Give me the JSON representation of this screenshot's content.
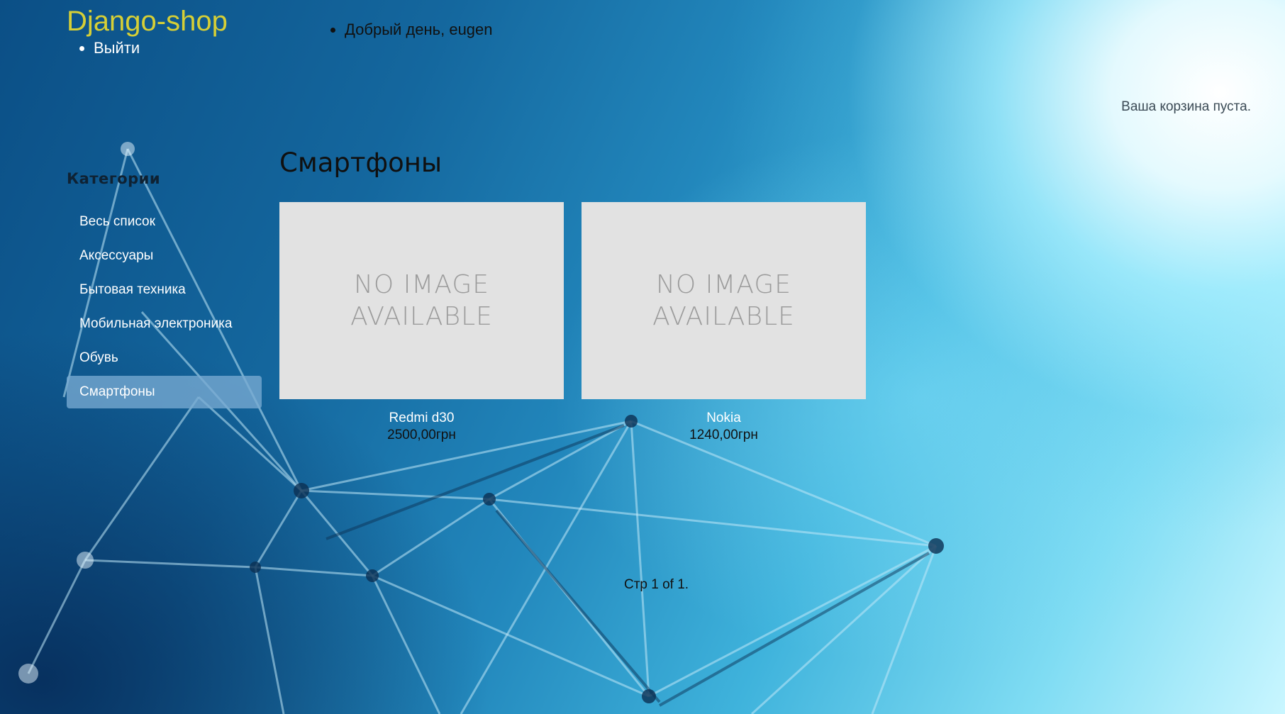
{
  "header": {
    "logo": "Django-shop",
    "greeting": "Добрый день, eugen",
    "logout": "Выйти"
  },
  "cart": {
    "status": "Ваша корзина пуста."
  },
  "sidebar": {
    "title": "Категории",
    "items": [
      {
        "label": "Весь список",
        "active": false
      },
      {
        "label": "Аксессуары",
        "active": false
      },
      {
        "label": "Бытовая техника",
        "active": false
      },
      {
        "label": "Мобильная электроника",
        "active": false
      },
      {
        "label": "Обувь",
        "active": false
      },
      {
        "label": "Смартфоны",
        "active": true
      }
    ]
  },
  "main": {
    "title": "Смартфоны",
    "products": [
      {
        "image_text": "NO IMAGE AVAILABLE",
        "name": "Redmi d30",
        "price": "2500,00грн"
      },
      {
        "image_text": "NO IMAGE AVAILABLE",
        "name": "Nokia",
        "price": "1240,00грн"
      }
    ]
  },
  "pagination": {
    "text": "Стр 1 of 1."
  },
  "colors": {
    "logo": "#d6cf36",
    "active_category_bg": "#78aad2",
    "placeholder_bg": "#e2e2e2",
    "placeholder_text": "#9c9c9c"
  }
}
